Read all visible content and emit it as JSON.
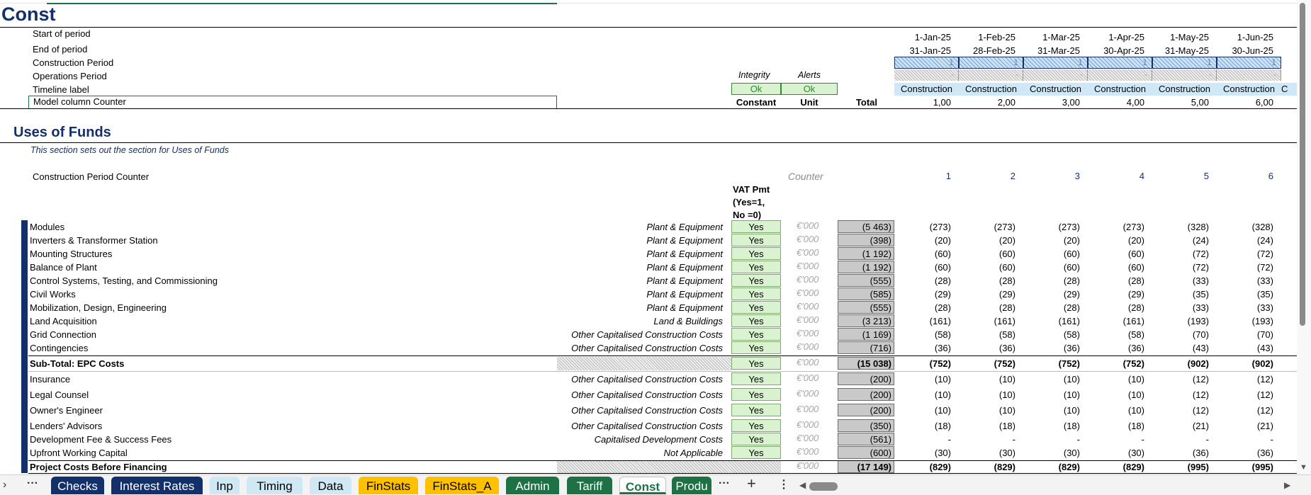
{
  "sheet_title": "Const",
  "header_rows": {
    "start_of_period": "Start of period",
    "end_of_period": "End of period",
    "construction_period": "Construction Period",
    "operations_period": "Operations Period",
    "timeline_label": "Timeline label",
    "model_column_counter": "Model column Counter"
  },
  "checks": {
    "integrity_label": "Integrity",
    "alerts_label": "Alerts",
    "integrity_value": "Ok",
    "alerts_value": "Ok",
    "constant_label": "Constant",
    "unit_label": "Unit",
    "total_label": "Total"
  },
  "periods": {
    "start": [
      "1-Jan-25",
      "1-Feb-25",
      "1-Mar-25",
      "1-Apr-25",
      "1-May-25",
      "1-Jun-25"
    ],
    "end": [
      "31-Jan-25",
      "28-Feb-25",
      "31-Mar-25",
      "30-Apr-25",
      "31-May-25",
      "30-Jun-25"
    ],
    "construction_flags": [
      "1",
      "1",
      "1",
      "1",
      "1",
      "1"
    ],
    "operations_flags": [
      "-",
      "-",
      "-",
      "-",
      "-",
      "-"
    ],
    "timeline_labels": [
      "Construction",
      "Construction",
      "Construction",
      "Construction",
      "Construction",
      "Construction",
      "C"
    ],
    "counters": [
      "1,00",
      "2,00",
      "3,00",
      "4,00",
      "5,00",
      "6,00"
    ]
  },
  "uses": {
    "section_title": "Uses of Funds",
    "note": "This section sets out the section for Uses of Funds",
    "counter_row_label": "Construction Period Counter",
    "counter_col_label": "Counter",
    "counter_values": [
      "1",
      "2",
      "3",
      "4",
      "5",
      "6"
    ],
    "vat_header": [
      "VAT  Pmt",
      "(Yes=1,",
      "No =0)"
    ],
    "unit": "€'000",
    "rows": [
      {
        "label": "Modules",
        "cat": "Plant & Equipment",
        "vat": "Yes",
        "total": "(5 463)",
        "vals": [
          "(273)",
          "(273)",
          "(273)",
          "(273)",
          "(328)",
          "(328)"
        ]
      },
      {
        "label": "Inverters & Transformer Station",
        "cat": "Plant & Equipment",
        "vat": "Yes",
        "total": "(398)",
        "vals": [
          "(20)",
          "(20)",
          "(20)",
          "(20)",
          "(24)",
          "(24)"
        ]
      },
      {
        "label": "Mounting Structures",
        "cat": "Plant & Equipment",
        "vat": "Yes",
        "total": "(1 192)",
        "vals": [
          "(60)",
          "(60)",
          "(60)",
          "(60)",
          "(72)",
          "(72)"
        ]
      },
      {
        "label": "Balance of Plant",
        "cat": "Plant & Equipment",
        "vat": "Yes",
        "total": "(1 192)",
        "vals": [
          "(60)",
          "(60)",
          "(60)",
          "(60)",
          "(72)",
          "(72)"
        ]
      },
      {
        "label": "Control Systems, Testing, and Commissioning",
        "cat": "Plant & Equipment",
        "vat": "Yes",
        "total": "(555)",
        "vals": [
          "(28)",
          "(28)",
          "(28)",
          "(28)",
          "(33)",
          "(33)"
        ]
      },
      {
        "label": "Civil Works",
        "cat": "Plant & Equipment",
        "vat": "Yes",
        "total": "(585)",
        "vals": [
          "(29)",
          "(29)",
          "(29)",
          "(29)",
          "(35)",
          "(35)"
        ]
      },
      {
        "label": "Mobilization, Design, Engineering",
        "cat": "Plant & Equipment",
        "vat": "Yes",
        "total": "(555)",
        "vals": [
          "(28)",
          "(28)",
          "(28)",
          "(28)",
          "(33)",
          "(33)"
        ]
      },
      {
        "label": "Land Acquisition",
        "cat": "Land & Buildings",
        "vat": "Yes",
        "total": "(3 213)",
        "vals": [
          "(161)",
          "(161)",
          "(161)",
          "(161)",
          "(193)",
          "(193)"
        ]
      },
      {
        "label": "Grid Connection",
        "cat": "Other Capitalised Construction Costs",
        "vat": "Yes",
        "total": "(1 169)",
        "vals": [
          "(58)",
          "(58)",
          "(58)",
          "(58)",
          "(70)",
          "(70)"
        ]
      },
      {
        "label": "Contingencies",
        "cat": "Other Capitalised Construction Costs",
        "vat": "Yes",
        "total": "(716)",
        "vals": [
          "(36)",
          "(36)",
          "(36)",
          "(36)",
          "(43)",
          "(43)"
        ]
      },
      {
        "label": "Sub-Total: EPC Costs",
        "cat": "",
        "vat": "Yes",
        "total": "(15 038)",
        "vals": [
          "(752)",
          "(752)",
          "(752)",
          "(752)",
          "(902)",
          "(902)"
        ]
      },
      {
        "label": "Insurance",
        "cat": "Other Capitalised Construction Costs",
        "vat": "Yes",
        "total": "(200)",
        "vals": [
          "(10)",
          "(10)",
          "(10)",
          "(10)",
          "(12)",
          "(12)"
        ]
      },
      {
        "label": "Legal Counsel",
        "cat": "Other Capitalised Construction Costs",
        "vat": "Yes",
        "total": "(200)",
        "vals": [
          "(10)",
          "(10)",
          "(10)",
          "(10)",
          "(12)",
          "(12)"
        ]
      },
      {
        "label": "Owner's Engineer",
        "cat": "Other Capitalised Construction Costs",
        "vat": "Yes",
        "total": "(200)",
        "vals": [
          "(10)",
          "(10)",
          "(10)",
          "(10)",
          "(12)",
          "(12)"
        ]
      },
      {
        "label": "Lenders' Advisors",
        "cat": "Other Capitalised Construction Costs",
        "vat": "Yes",
        "total": "(350)",
        "vals": [
          "(18)",
          "(18)",
          "(18)",
          "(18)",
          "(21)",
          "(21)"
        ]
      },
      {
        "label": "Development Fee & Success Fees",
        "cat": "Capitalised Development Costs",
        "vat": "Yes",
        "total": "(561)",
        "vals": [
          "-",
          "-",
          "-",
          "-",
          "-",
          "-"
        ]
      },
      {
        "label": "Upfront Working Capital",
        "cat": "Not Applicable",
        "vat": "Yes",
        "total": "(600)",
        "vals": [
          "(30)",
          "(30)",
          "(30)",
          "(30)",
          "(36)",
          "(36)"
        ]
      },
      {
        "label": "Project Costs Before Financing",
        "cat": "",
        "vat": "",
        "total": "(17 149)",
        "vals": [
          "(829)",
          "(829)",
          "(829)",
          "(829)",
          "(995)",
          "(995)"
        ]
      }
    ]
  },
  "tabs": [
    {
      "label": "Checks",
      "bg": "#13306a",
      "fg": "#ffffff"
    },
    {
      "label": "Interest Rates",
      "bg": "#13306a",
      "fg": "#ffffff"
    },
    {
      "label": "Inp",
      "bg": "#cfe8f3",
      "fg": "#000000"
    },
    {
      "label": "Timing",
      "bg": "#cfe8f3",
      "fg": "#000000"
    },
    {
      "label": "Data",
      "bg": "#cfe8f3",
      "fg": "#000000"
    },
    {
      "label": "FinStats",
      "bg": "#ffc000",
      "fg": "#000000"
    },
    {
      "label": "FinStats_A",
      "bg": "#ffc000",
      "fg": "#000000"
    },
    {
      "label": "Admin",
      "bg": "#1e7145",
      "fg": "#ffffff"
    },
    {
      "label": "Tariff",
      "bg": "#1e7145",
      "fg": "#ffffff"
    },
    {
      "label": "Const",
      "bg": "#ffffff",
      "fg": "#1e7145"
    },
    {
      "label": "Produ",
      "bg": "#1e7145",
      "fg": "#ffffff"
    }
  ],
  "tabbar_icons": {
    "prev": "chevron-right-icon",
    "more": "more-horizontal-icon",
    "add": "plus-icon",
    "options": "more-vertical-icon"
  }
}
